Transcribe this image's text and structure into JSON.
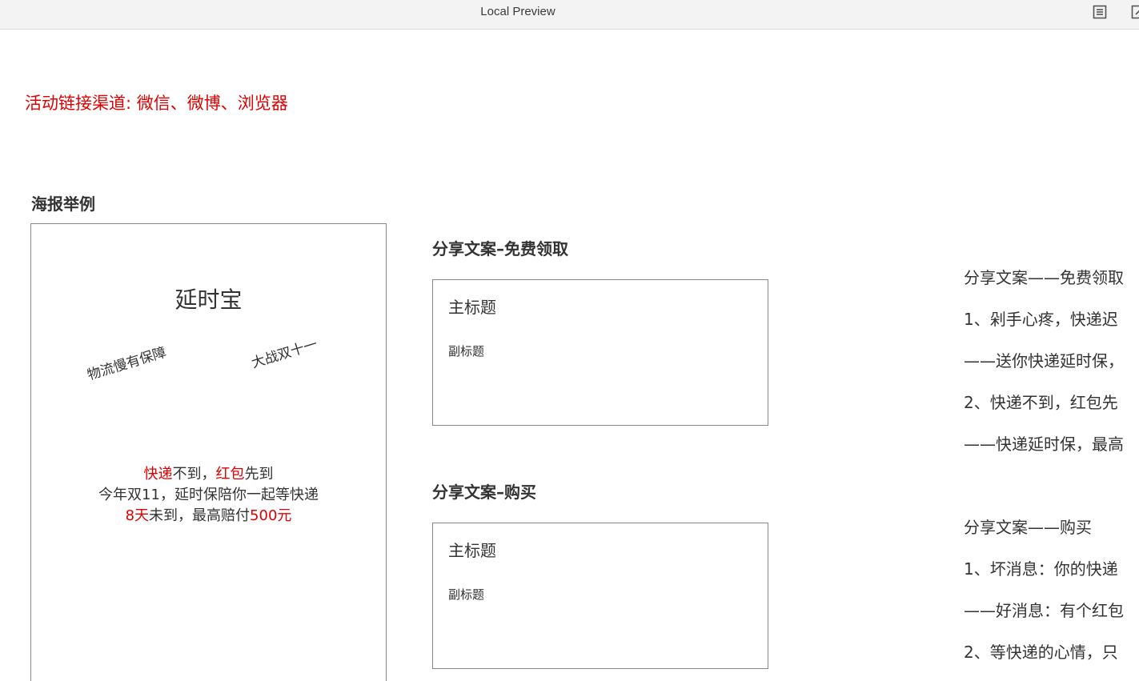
{
  "window": {
    "title": "Local Preview"
  },
  "channel": {
    "text": "活动链接渠道: 微信、微博、浏览器"
  },
  "poster": {
    "section_label": "海报举例",
    "title": "延时宝",
    "tag_left": "物流慢有保障",
    "tag_right": "大战双十一",
    "line1": {
      "red_a": "快递",
      "plain_a": "不到，",
      "red_b": "红包",
      "plain_b": "先到"
    },
    "line2": "今年双11，延时保陪你一起等快递",
    "line3": {
      "red_a": "8天",
      "plain_a": "未到，最高赔付",
      "red_b": "500元"
    }
  },
  "share_free": {
    "label": "分享文案–免费领取",
    "main_title": "主标题",
    "sub_title": "副标题"
  },
  "share_buy": {
    "label": "分享文案–购买",
    "main_title": "主标题",
    "sub_title": "副标题"
  },
  "copy_text": {
    "free": [
      "分享文案——免费领取",
      "1、剁手心疼，快递迟",
      "——送你快递延时保，",
      "2、快递不到，红包先",
      "——快递延时保，最高"
    ],
    "buy": [
      "分享文案——购买",
      "1、坏消息：你的快递",
      "——好消息：有个红包",
      "2、等快递的心情，只"
    ]
  }
}
